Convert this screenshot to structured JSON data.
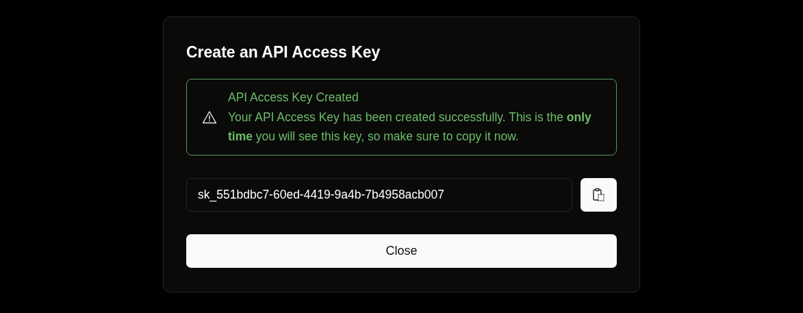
{
  "dialog": {
    "title": "Create an API Access Key",
    "alert": {
      "kind": "warning",
      "title": "API Access Key Created",
      "message": "Your API Access Key has been created successfully. This is the **only time** you will see this key, so make sure to copy it now."
    },
    "key_field": {
      "value": "sk_551bdbc7-60ed-4419-9a4b-7b4958acb007"
    },
    "buttons": [
      {
        "label": "Close"
      }
    ]
  }
}
